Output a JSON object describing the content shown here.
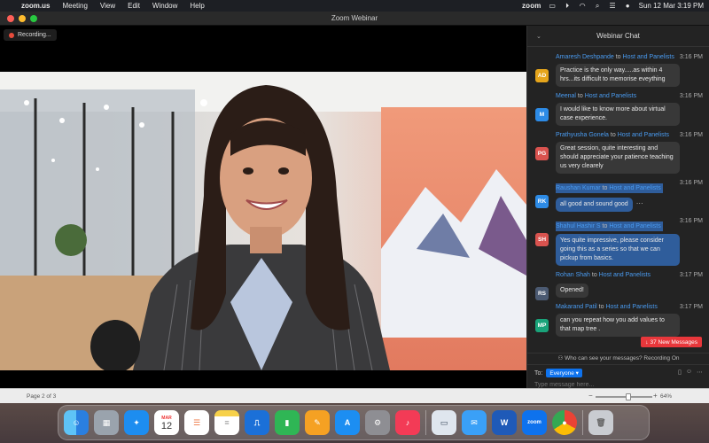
{
  "menubar": {
    "app_name": "zoom.us",
    "items": [
      "Meeting",
      "View",
      "Edit",
      "Window",
      "Help"
    ],
    "brand": "zoom",
    "datetime": "Sun 12 Mar  3:19 PM"
  },
  "window": {
    "title": "Zoom Webinar",
    "recording_label": "Recording..."
  },
  "chat": {
    "title": "Webinar Chat",
    "messages": [
      {
        "sender": "Amaresh Deshpande",
        "to": "to",
        "target": "Host and Panelists",
        "time": "3:16 PM",
        "initials": "AD",
        "avatar_color": "#e5a51c",
        "text": "Practice is the only way.....as within 4 hrs...its difficult to memorise eveything"
      },
      {
        "sender": "Meenal",
        "to": "to",
        "target": "Host and Panelists",
        "time": "3:16 PM",
        "initials": "M",
        "avatar_color": "#2d8be6",
        "text": "I would like to know more about virtual case experience."
      },
      {
        "sender": "Prathyusha Gonela",
        "to": "to",
        "target": "Host and Panelists",
        "time": "3:16 PM",
        "initials": "PG",
        "avatar_color": "#d9534f",
        "text": "Great session, quite interesting and should appreciate your patience teaching us very clearely"
      },
      {
        "sender": "Raushan Kumar",
        "to": "to",
        "target": "Host and Panelists",
        "time": "3:16 PM",
        "initials": "RK",
        "avatar_color": "#2d8be6",
        "text": "all good and sound good",
        "more": "···"
      },
      {
        "sender": "Shahul Hashir S",
        "to": "to",
        "target": "Host and Panelists",
        "time": "3:16 PM",
        "initials": "SH",
        "avatar_color": "#d9534f",
        "text": "Yes quite impressive, please consider going this as a series so that we can pickup from basics."
      },
      {
        "sender": "Rohan Shah",
        "to": "to",
        "target": "Host and Panelists",
        "time": "3:17 PM",
        "initials": "RS",
        "avatar_color": "#4b5a72",
        "text": "Opened!"
      },
      {
        "sender": "Makarand Patil",
        "to": "to",
        "target": "Host and Panelists",
        "time": "3:17 PM",
        "initials": "MP",
        "avatar_color": "#1aa37a",
        "text": "can you repeat how you add values to that map tree ."
      }
    ],
    "new_messages": "37 New Messages",
    "privacy_note": "Who can see your messages? Recording On",
    "to_label": "To:",
    "recipient": "Everyone",
    "placeholder": "Type message here..."
  },
  "status": {
    "page": "Page 2 of 3",
    "zoom": "64%",
    "zoom_level": 0.64
  },
  "dock": {
    "calendar_month": "MAR",
    "calendar_day": "12",
    "zoom_label": "zoom",
    "word_label": "W"
  },
  "colors": {
    "highlight": "#2f5d9b",
    "link_blue": "#4a9bf0",
    "accent": "#0e72ed",
    "alert": "#e8373b"
  }
}
